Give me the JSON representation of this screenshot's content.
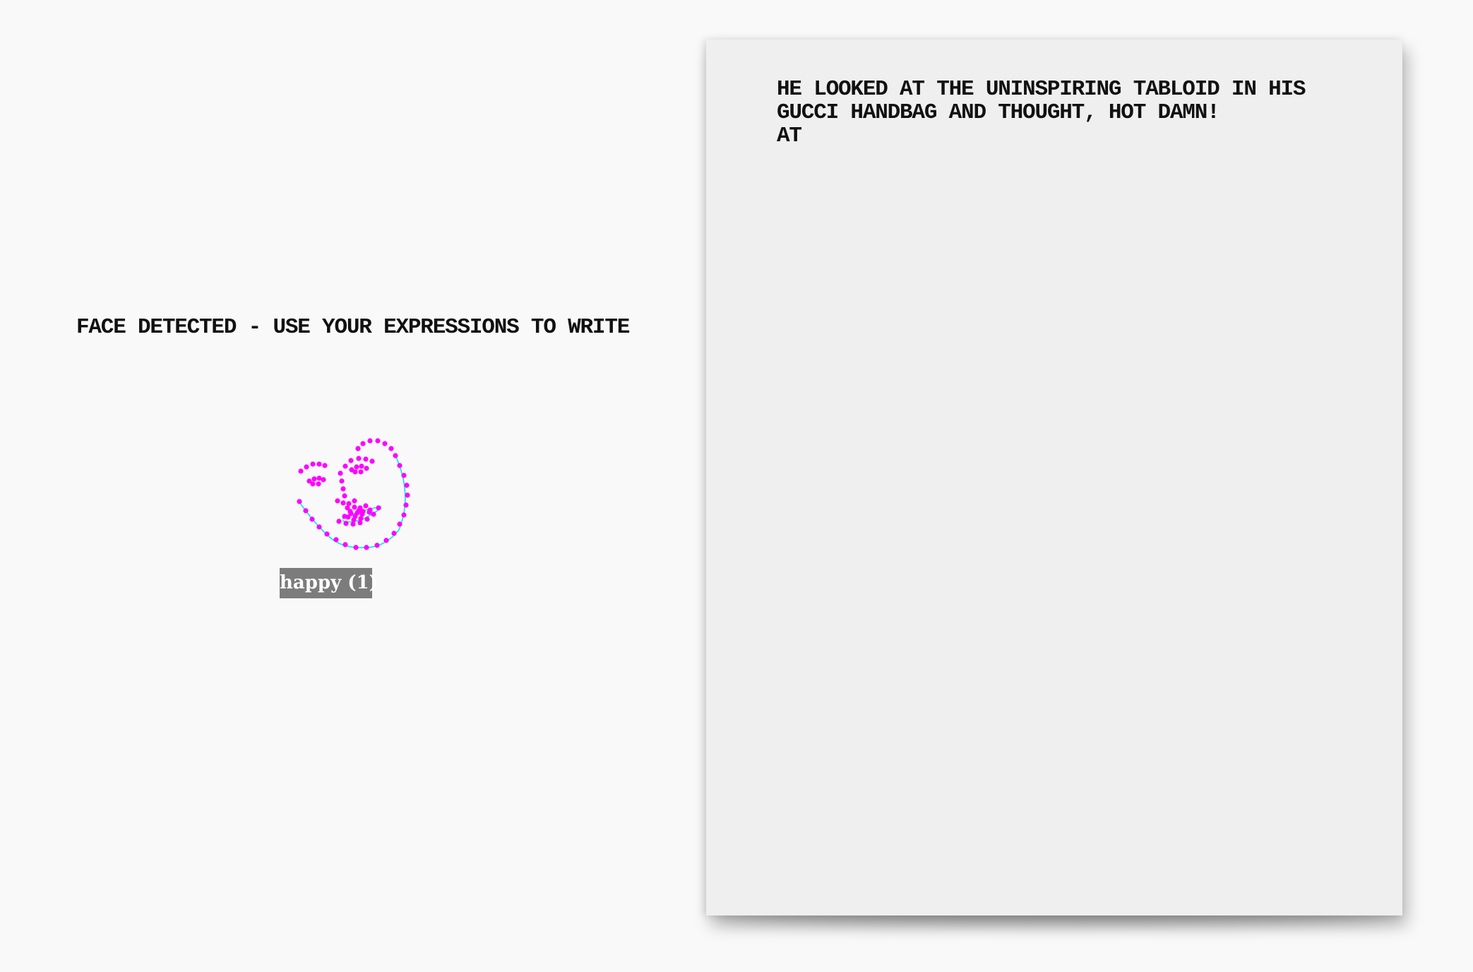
{
  "status": {
    "message": "FACE DETECTED - USE YOUR EXPRESSIONS TO WRITE"
  },
  "face_tracker": {
    "expression_label": "happy (1)",
    "landmark_color": "#ff00ff",
    "contour_color": "#00e5ff",
    "label_background": "#7c7c7c"
  },
  "paper": {
    "lines": [
      "HE LOOKED AT THE UNINSPIRING TABLOID IN HIS",
      "GUCCI HANDBAG AND THOUGHT, HOT DAMN!",
      "AT"
    ]
  }
}
